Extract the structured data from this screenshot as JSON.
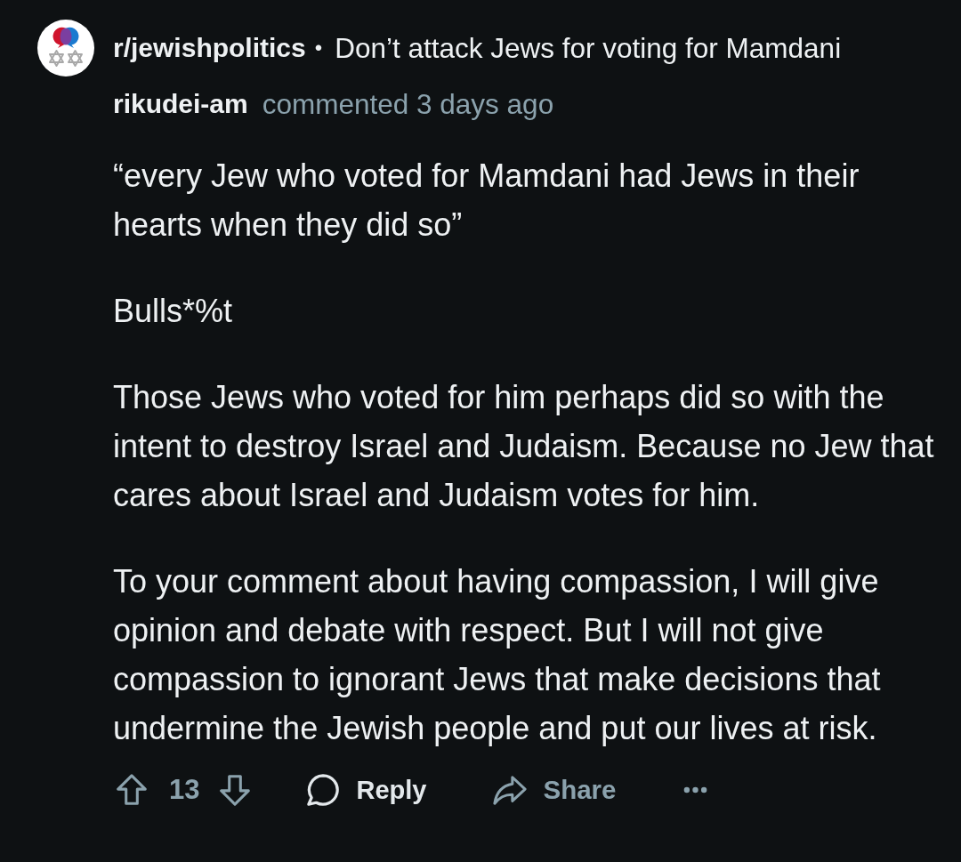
{
  "post": {
    "subreddit": "r/jewishpolitics",
    "separator": "•",
    "title": "Don’t attack Jews for voting for Mamdani"
  },
  "comment": {
    "author": "rikudei-am",
    "meta": "commented 3 days ago",
    "paragraphs": [
      "“every Jew who voted for Mamdani had Jews in their hearts when they did so”",
      "Bulls*%t",
      "Those Jews who voted for him perhaps did so with the intent to destroy Israel and Judaism. Because no Jew that cares about Israel and Judaism votes for him.",
      "To your comment about having compassion, I will give opinion and debate with respect. But I will not give compassion to ignorant Jews that make decisions that undermine the Jewish people and put our lives at risk."
    ]
  },
  "actions": {
    "score": "13",
    "reply": "Reply",
    "share": "Share"
  }
}
